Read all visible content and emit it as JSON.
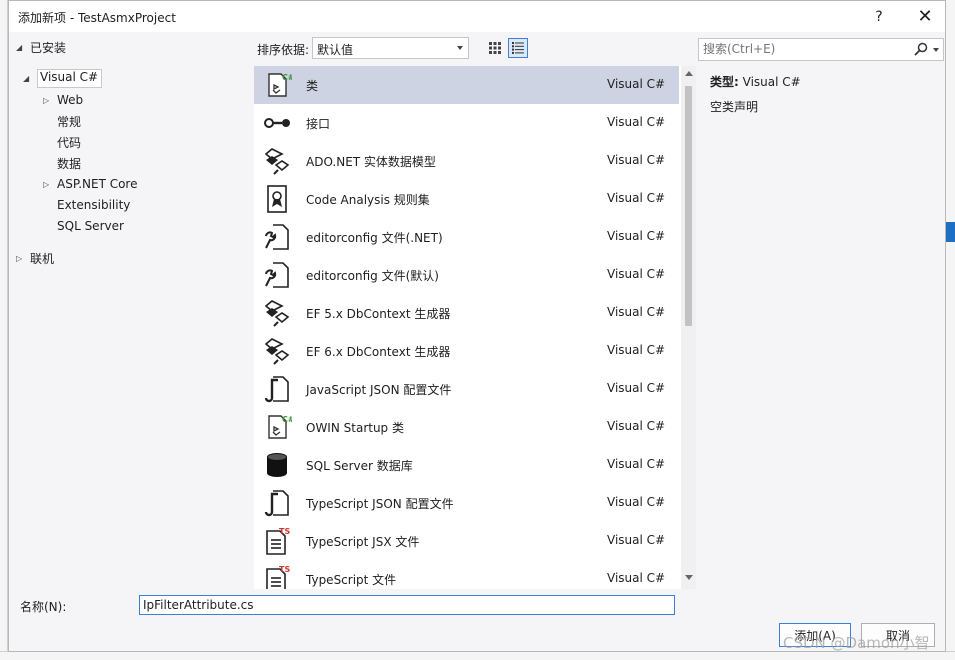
{
  "dialog": {
    "title": "添加新项 - TestAsmxProject",
    "help_label": "?",
    "close_label": "✕"
  },
  "tree": {
    "installed": "已安装",
    "visual_csharp": "Visual C#",
    "web": "Web",
    "general": "常规",
    "code": "代码",
    "data": "数据",
    "aspnet_core": "ASP.NET Core",
    "extensibility": "Extensibility",
    "sql_server": "SQL Server",
    "online": "联机"
  },
  "sortbar": {
    "label": "排序依据:",
    "value": "默认值"
  },
  "items": [
    {
      "name": "类",
      "lang": "Visual C#",
      "icon": "class-icon",
      "selected": true
    },
    {
      "name": "接口",
      "lang": "Visual C#",
      "icon": "interface-icon"
    },
    {
      "name": "ADO.NET 实体数据模型",
      "lang": "Visual C#",
      "icon": "entity-model-icon"
    },
    {
      "name": "Code Analysis 规则集",
      "lang": "Visual C#",
      "icon": "ruleset-icon"
    },
    {
      "name": "editorconfig 文件(.NET)",
      "lang": "Visual C#",
      "icon": "editorconfig-icon"
    },
    {
      "name": "editorconfig 文件(默认)",
      "lang": "Visual C#",
      "icon": "editorconfig-icon"
    },
    {
      "name": "EF 5.x DbContext 生成器",
      "lang": "Visual C#",
      "icon": "entity-model-icon"
    },
    {
      "name": "EF 6.x DbContext 生成器",
      "lang": "Visual C#",
      "icon": "entity-model-icon"
    },
    {
      "name": "JavaScript JSON 配置文件",
      "lang": "Visual C#",
      "icon": "json-config-icon"
    },
    {
      "name": "OWIN Startup 类",
      "lang": "Visual C#",
      "icon": "class-icon"
    },
    {
      "name": "SQL Server 数据库",
      "lang": "Visual C#",
      "icon": "database-icon"
    },
    {
      "name": "TypeScript JSON 配置文件",
      "lang": "Visual C#",
      "icon": "json-config-icon"
    },
    {
      "name": "TypeScript JSX 文件",
      "lang": "Visual C#",
      "icon": "typescript-file-icon"
    },
    {
      "name": "TypeScript 文件",
      "lang": "Visual C#",
      "icon": "typescript-file-icon"
    }
  ],
  "search": {
    "placeholder": "搜索(Ctrl+E)"
  },
  "details": {
    "type_label": "类型:",
    "type_value": "Visual C#",
    "description": "空类声明"
  },
  "name_field": {
    "label": "名称(N):",
    "value": "IpFilterAttribute.cs"
  },
  "buttons": {
    "add": "添加(A)",
    "cancel": "取消"
  },
  "watermark": "CSDN @Damon小智",
  "colors": {
    "accent": "#3c7fd6",
    "selection": "#cdd3e2",
    "csharp_green": "#3a8e3a",
    "ts_red": "#c8392b"
  }
}
